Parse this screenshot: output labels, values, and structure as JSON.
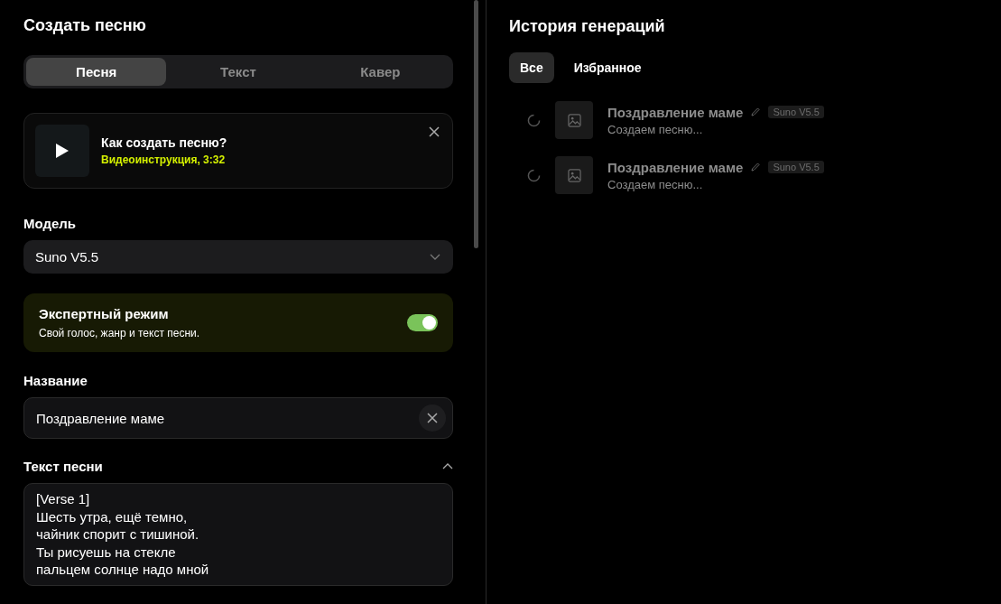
{
  "create": {
    "title": "Создать песню",
    "tabs": [
      {
        "label": "Песня",
        "selected": true
      },
      {
        "label": "Текст",
        "selected": false
      },
      {
        "label": "Кавер",
        "selected": false
      }
    ],
    "video": {
      "title": "Как создать песню?",
      "subtitle": "Видеоинструкция, 3:32"
    },
    "model": {
      "label": "Модель",
      "value": "Suno V5.5"
    },
    "expert": {
      "title": "Экспертный режим",
      "description": "Свой голос, жанр и текст песни.",
      "on": true
    },
    "name": {
      "label": "Название",
      "value": "Поздравление маме"
    },
    "lyrics": {
      "label": "Текст песни",
      "expanded": true,
      "value": "[Verse 1]\nШесть утра, ещё темно,\nчайник спорит с тишиной.\nТы рисуешь на стекле\nпальцем солнце надо мной"
    }
  },
  "history": {
    "title": "История генераций",
    "filters": [
      {
        "label": "Все",
        "selected": true
      },
      {
        "label": "Избранное",
        "selected": false
      }
    ],
    "items": [
      {
        "title": "Поздравление маме",
        "model": "Suno V5.5",
        "status": "Создаем песню..."
      },
      {
        "title": "Поздравление маме",
        "model": "Suno V5.5",
        "status": "Создаем песню..."
      }
    ]
  }
}
